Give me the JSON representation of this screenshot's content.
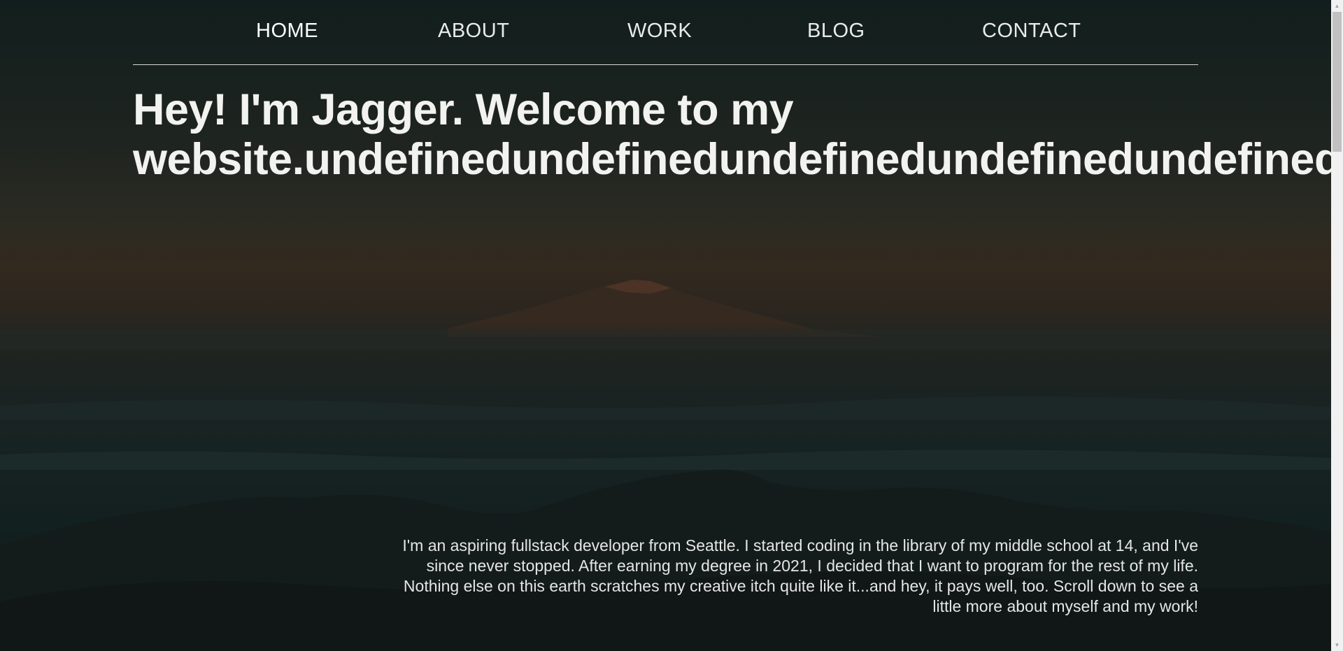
{
  "nav": {
    "items": [
      {
        "label": "HOME",
        "active": true
      },
      {
        "label": "ABOUT",
        "active": false
      },
      {
        "label": "WORK",
        "active": false
      },
      {
        "label": "BLOG",
        "active": false
      },
      {
        "label": "CONTACT",
        "active": false
      }
    ]
  },
  "hero": {
    "title_line1": "Hey! I'm Jagger. Welcome to my",
    "title_line2": "website.undefinedundefinedundefinedundefinedundefinedundefined"
  },
  "intro": {
    "text": "I'm an aspiring fullstack developer from Seattle. I started coding in the library of my middle school at 14, and I've since never stopped. After earning my degree in 2021, I decided that I want to program for the rest of my life. Nothing else on this earth scratches my creative itch quite like it...and hey, it pays well, too. Scroll down to see a little more about myself and my work!"
  },
  "colors": {
    "text": "#f2f2f0",
    "nav_divider": "#d6d9d7",
    "sky_top": "#121e1d",
    "sky_sunset": "#33291f",
    "ground": "#111a1a"
  },
  "icons": {
    "scroll_up": "scroll-up-arrow-icon",
    "scroll_down": "scroll-down-arrow-icon"
  }
}
